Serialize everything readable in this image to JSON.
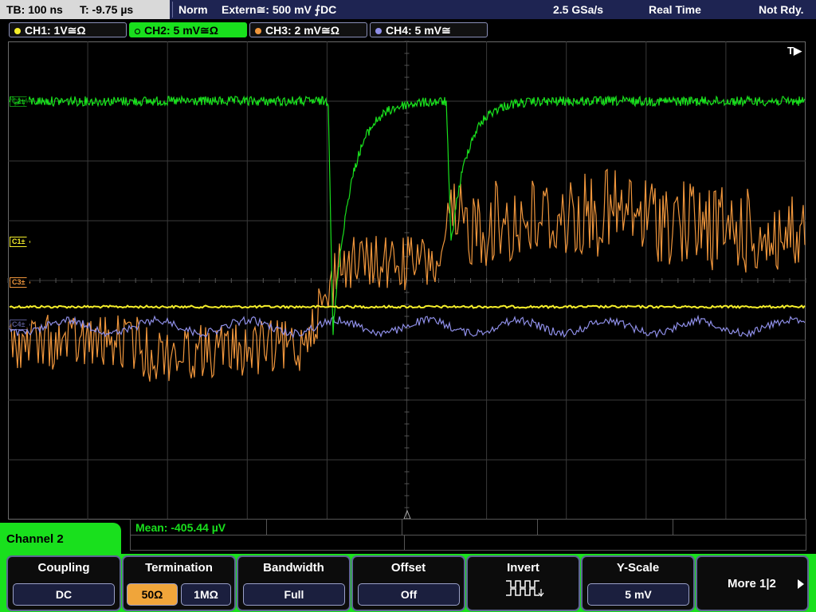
{
  "status": {
    "timebase": "TB: 100 ns",
    "trigger_time": "T: -9.75 µs",
    "trigger_mode": "Norm",
    "trigger_source": "Extern≅: 500 mV ⨍DC",
    "sample_rate": "2.5 GSa/s",
    "acq_mode": "Real Time",
    "ready_state": "Not Rdy."
  },
  "channels": [
    {
      "label": "CH1: 1V≅Ω",
      "color": "#f4ee2a"
    },
    {
      "label": "CH2: 5 mV≅Ω",
      "color": "#19e01d"
    },
    {
      "label": "CH3: 2 mV≅Ω",
      "color": "#f0963c"
    },
    {
      "label": "CH4: 5 mV≅",
      "color": "#8f8fe8"
    }
  ],
  "markers": {
    "c1": "C1±",
    "c3": "C3±",
    "c2": "C2±",
    "c4": "C4±"
  },
  "trigger_label": "T▶",
  "measurement": {
    "text": "Mean: -405.44 µV"
  },
  "menu": {
    "title": "Channel 2",
    "coupling": {
      "title": "Coupling",
      "value": "DC"
    },
    "termination": {
      "title": "Termination",
      "opt1": "50Ω",
      "opt2": "1MΩ",
      "selected": "50Ω"
    },
    "bandwidth": {
      "title": "Bandwidth",
      "value": "Full"
    },
    "offset": {
      "title": "Offset",
      "value": "Off"
    },
    "invert": {
      "title": "Invert",
      "icon": "inverted-square-wave-icon"
    },
    "yscale": {
      "title": "Y-Scale",
      "value": "5 mV"
    },
    "more": {
      "label": "More 1|2",
      "icon": "arrow-right-icon"
    }
  }
}
